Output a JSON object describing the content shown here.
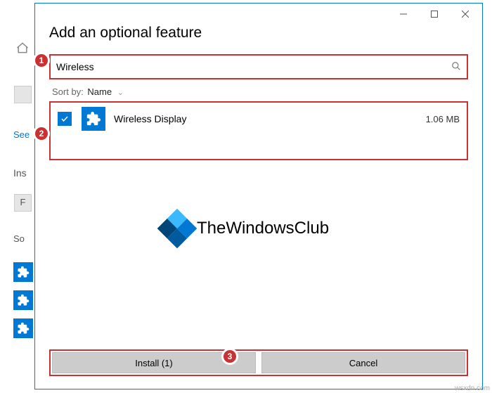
{
  "dialog": {
    "title": "Add an optional feature",
    "search_value": "Wireless",
    "sort_label": "Sort by:",
    "sort_value": "Name"
  },
  "feature": {
    "name": "Wireless Display",
    "size": "1.06 MB",
    "checked": true
  },
  "buttons": {
    "install": "Install (1)",
    "cancel": "Cancel"
  },
  "watermark": {
    "text": "TheWindowsClub"
  },
  "annotations": {
    "b1": "1",
    "b2": "2",
    "b3": "3"
  },
  "background": {
    "see": "See",
    "ins": "Ins",
    "f": "F",
    "so": "So"
  },
  "attribution": "wsxdn.com"
}
